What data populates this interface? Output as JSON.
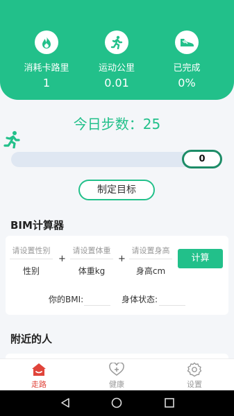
{
  "header": {
    "stats": [
      {
        "icon": "flame-icon",
        "label": "消耗卡路里",
        "value": "1"
      },
      {
        "icon": "running-person-icon",
        "label": "运动公里",
        "value": "0.01"
      },
      {
        "icon": "sneaker-icon",
        "label": "已完成",
        "value": "0%"
      }
    ]
  },
  "steps": {
    "title": "今日步数：25",
    "progress_value": "0",
    "progress_fraction": 0
  },
  "goal_button": "制定目标",
  "bmi": {
    "title": "BIM计算器",
    "gender_placeholder": "请设置性别",
    "gender_label": "性别",
    "weight_placeholder": "请设置体重",
    "weight_label": "体重kg",
    "height_placeholder": "请设置身高",
    "height_label": "身高cm",
    "plus": "+",
    "calc_button": "计算",
    "bmi_label": "你的BMI:",
    "status_label": "身体状态:"
  },
  "nearby": {
    "title": "附近的人"
  },
  "nav": {
    "items": [
      {
        "icon": "home-icon",
        "label": "走路",
        "active": true
      },
      {
        "icon": "heart-plus-icon",
        "label": "健康",
        "active": false
      },
      {
        "icon": "gear-icon",
        "label": "设置",
        "active": false
      }
    ]
  },
  "colors": {
    "accent": "#22c08a",
    "active_nav": "#e0443a",
    "inactive_nav": "#999999"
  }
}
